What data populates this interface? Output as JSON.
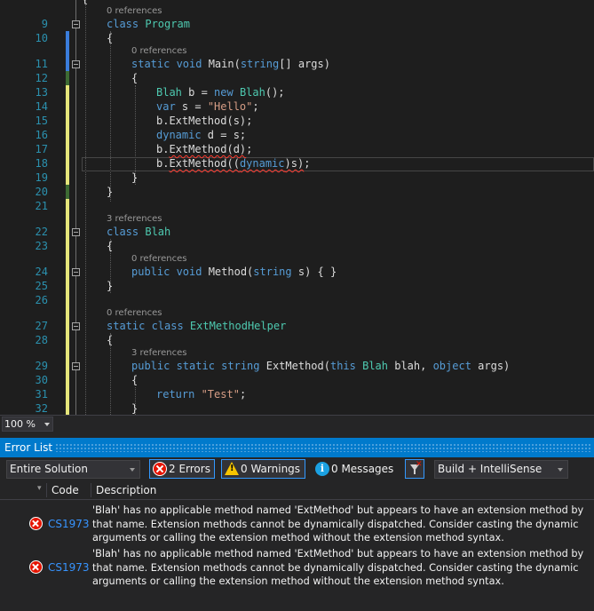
{
  "editor": {
    "line_numbers": [
      "9",
      "10",
      "11",
      "12",
      "13",
      "14",
      "15",
      "16",
      "17",
      "18",
      "19",
      "20",
      "21",
      "22",
      "23",
      "24",
      "25",
      "26",
      "27",
      "28",
      "29",
      "30",
      "31",
      "32"
    ],
    "lines": {
      "l9": {
        "refs": "0 references",
        "t1": "class ",
        "t2": "Program"
      },
      "l10": {
        "t1": "{"
      },
      "l11": {
        "refs": "0 references",
        "t1": "static void ",
        "t2": "Main(",
        "t3": "string",
        "t4": "[] args)"
      },
      "l12": {
        "t1": "{"
      },
      "l13": {
        "t1": "Blah",
        "t2": " b = ",
        "t3": "new ",
        "t4": "Blah",
        "t5": "();"
      },
      "l14": {
        "t1": "var",
        "t2": " s = ",
        "t3": "\"Hello\"",
        "t4": ";"
      },
      "l15": {
        "t1": "b.ExtMethod(s);"
      },
      "l16": {
        "t1": "dynamic",
        "t2": " d = s;"
      },
      "l17": {
        "t1": "b.",
        "t2": "ExtMethod(d)",
        "t3": ";"
      },
      "l18": {
        "t1": "b.",
        "t2": "ExtMethod((",
        "t3": "dynamic",
        "t4": ")s)",
        "t5": ";"
      },
      "l19": {
        "t1": "}"
      },
      "l20": {
        "t1": "}"
      },
      "l22": {
        "refs": "3 references",
        "t1": "class ",
        "t2": "Blah"
      },
      "l23": {
        "t1": "{"
      },
      "l24": {
        "refs": "0 references",
        "t1": "public void ",
        "t2": "Method(",
        "t3": "string",
        "t4": " s) { }"
      },
      "l25": {
        "t1": "}"
      },
      "l27": {
        "refs": "0 references",
        "t1": "static class ",
        "t2": "ExtMethodHelper"
      },
      "l28": {
        "t1": "{"
      },
      "l29": {
        "refs": "3 references",
        "t1": "public static string ",
        "t2": "ExtMethod(",
        "t3": "this ",
        "t4": "Blah",
        "t5": " blah, ",
        "t6": "object",
        "t7": " args)"
      },
      "l30": {
        "t1": "{"
      },
      "l31": {
        "t1": "return ",
        "t2": "\"Test\"",
        "t3": ";"
      },
      "l32": {
        "t1": "}"
      }
    }
  },
  "zoom": "100 %",
  "error_list": {
    "title": "Error List",
    "scope": "Entire Solution",
    "errors_label": "2 Errors",
    "warnings_label": "0 Warnings",
    "messages_label": "0 Messages",
    "source": "Build + IntelliSense",
    "columns": {
      "code": "Code",
      "description": "Description"
    },
    "rows": [
      {
        "code": "CS1973",
        "description": "'Blah' has no applicable method named 'ExtMethod' but appears to have an extension method by that name. Extension methods cannot be dynamically dispatched. Consider casting the dynamic arguments or calling the extension method without the extension method syntax."
      },
      {
        "code": "CS1973",
        "description": "'Blah' has no applicable method named 'ExtMethod' but appears to have an extension method by that name. Extension methods cannot be dynamically dispatched. Consider casting the dynamic arguments or calling the extension method without the extension method syntax."
      }
    ]
  },
  "colors": {
    "keyword": "#569cd6",
    "type": "#4ec9b0",
    "string": "#d69d85",
    "accent": "#007acc",
    "error": "#e51400"
  }
}
